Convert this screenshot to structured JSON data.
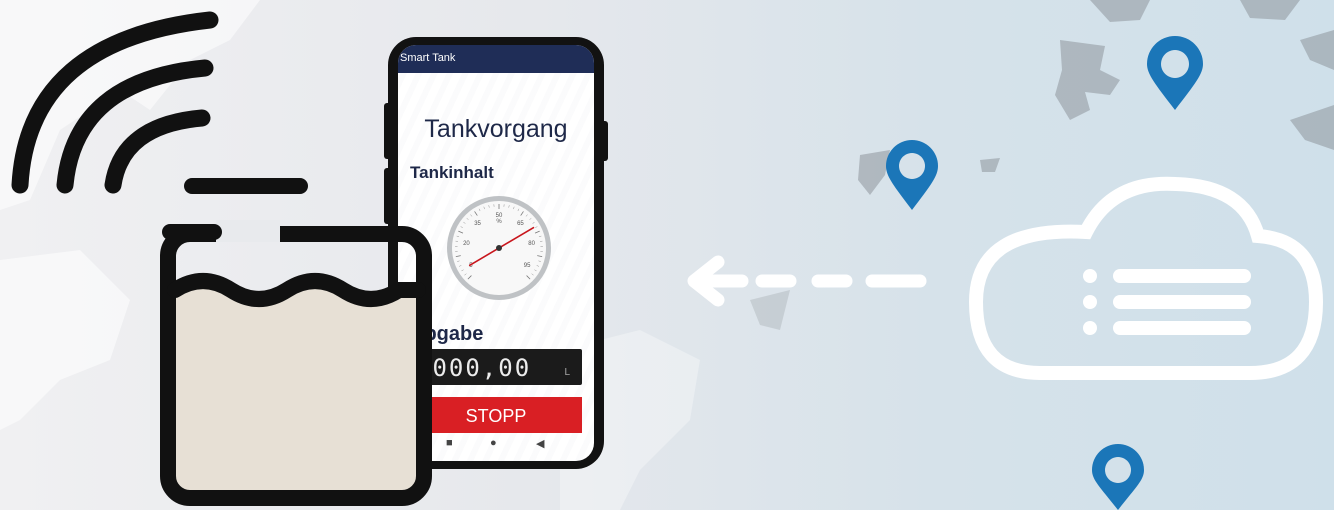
{
  "app": {
    "title": "Smart Tank",
    "screen_title": "Tankvorgang",
    "tank_label": "Tankinhalt",
    "output_label": "Abgabe",
    "output_value": "0000,00",
    "output_unit": "L",
    "stop_label": "STOPP"
  },
  "gauge": {
    "unit": "%",
    "ticks": [
      "5",
      "20",
      "35",
      "50",
      "65",
      "80",
      "95"
    ],
    "needle_value": 72
  },
  "nav": {
    "square_icon": "■",
    "circle_icon": "●",
    "back_icon": "◀"
  },
  "colors": {
    "app_bar": "#1f2d57",
    "stop_button": "#d91f24",
    "pin": "#1b76b8",
    "tank_fill": "#e7e0d5"
  },
  "icons": [
    "wifi-signal-icon",
    "water-tank-icon",
    "cloud-list-icon",
    "dashed-arrow-icon",
    "location-pin-icon"
  ]
}
